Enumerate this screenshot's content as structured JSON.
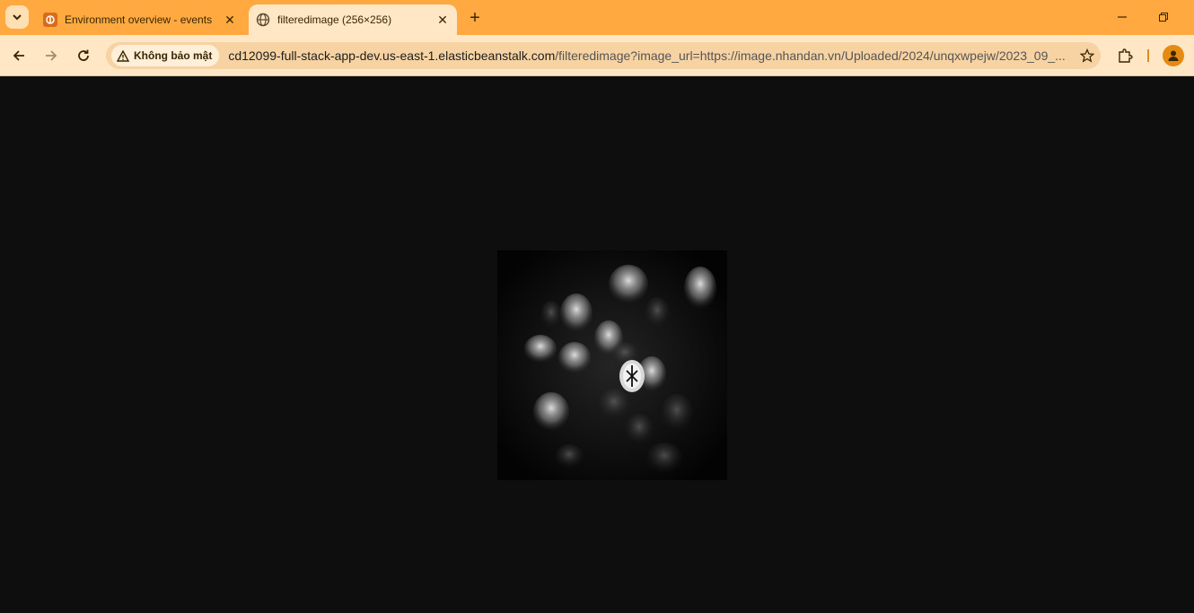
{
  "browser": {
    "tabs": [
      {
        "title": "Environment overview - events",
        "favicon": "elastic-beanstalk-icon",
        "active": false
      },
      {
        "title": "filteredimage (256×256)",
        "favicon": "globe-icon",
        "active": true
      }
    ],
    "security_label": "Không bảo mật",
    "url_host": "cd12099-full-stack-app-dev.us-east-1.elasticbeanstalk.com",
    "url_path": "/filteredimage?image_url=https://image.nhandan.vn/Uploaded/2024/unqxwpejw/2023_09_..."
  },
  "content": {
    "image_alt": "filtered grayscale image",
    "background": "#0e0e0e"
  },
  "colors": {
    "tabstrip": "#ffa940",
    "toolbar": "#ffe7c6",
    "omnibox": "#f7d3a3"
  }
}
